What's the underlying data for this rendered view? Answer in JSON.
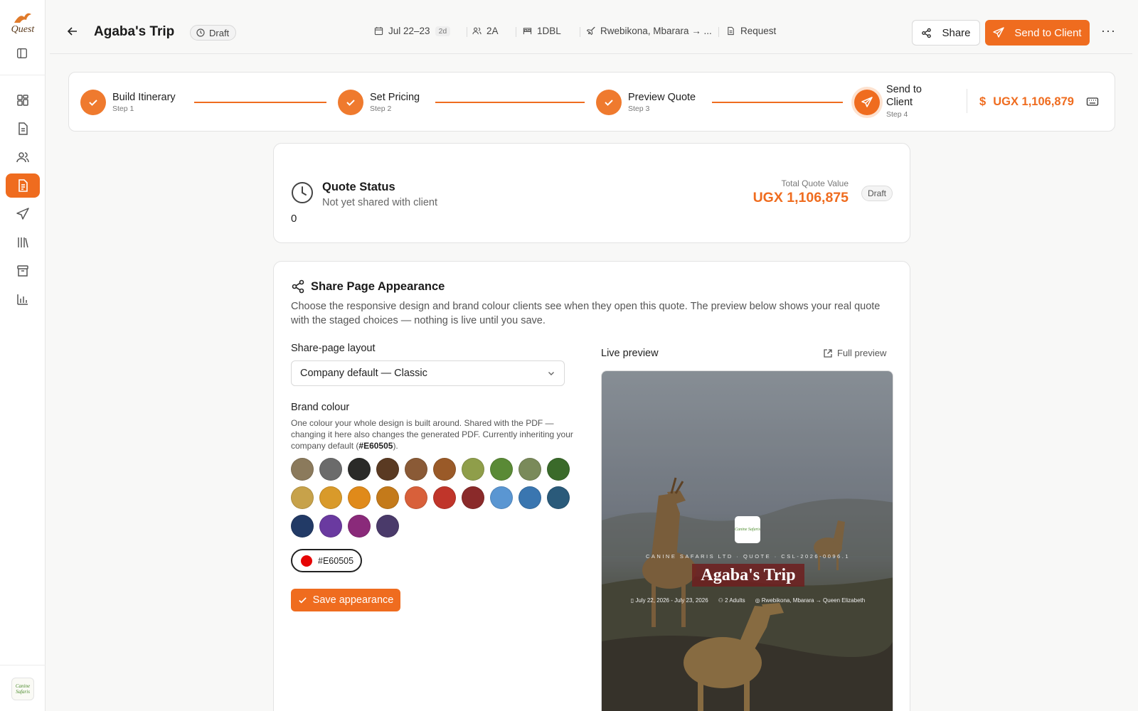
{
  "app": {
    "logo_text": "Quest",
    "avatar_text": "Canine Safaris"
  },
  "header": {
    "trip_title": "Agaba's Trip",
    "status_pill": "Draft",
    "dates": "Jul 22–23",
    "duration": "2d",
    "adults": "2A",
    "rooms": "1DBL",
    "route": "Rwebikona, Mbarara → ...",
    "request": "Request",
    "share_label": "Share",
    "send_label": "Send to Client",
    "more_label": "···"
  },
  "stepper": {
    "steps": [
      {
        "label": "Build Itinerary",
        "sub": "Step 1"
      },
      {
        "label": "Set Pricing",
        "sub": "Step 2"
      },
      {
        "label": "Preview Quote",
        "sub": "Step 3"
      },
      {
        "label": "Send to",
        "label2": "Client",
        "sub": "Step 4"
      }
    ],
    "currency_symbol": "$",
    "total": "UGX 1,106,879"
  },
  "quote_status": {
    "title": "Quote Status",
    "subtitle": "Not yet shared with client",
    "count": "0",
    "total_label": "Total Quote Value",
    "total_value": "UGX 1,106,875",
    "badge": "Draft"
  },
  "appearance": {
    "title": "Share Page Appearance",
    "description": "Choose the responsive design and brand colour clients see when they open this quote. The preview below shows your real quote with the staged choices — nothing is live until you save.",
    "layout_label": "Share-page layout",
    "layout_value": "Company default — Classic",
    "brand_label": "Brand colour",
    "brand_desc_1": "One colour your whole design is built around. Shared with the PDF — changing it here also changes the generated PDF. Currently inheriting your company default (",
    "brand_desc_hex": "#E60505",
    "brand_desc_2": ").",
    "swatches": [
      "#8b7a5c",
      "#6b6b6b",
      "#2a2a28",
      "#5a3a22",
      "#8a5a36",
      "#9a5a28",
      "#8f9e4a",
      "#5a8a36",
      "#7a8a5a",
      "#3a6a2a",
      "#c7a24a",
      "#d99a2a",
      "#e08a1a",
      "#c47a1a",
      "#d8603a",
      "#c0352a",
      "#8a2a2a",
      "#5a96d2",
      "#3a76b0",
      "#2a5a7a",
      "#223a66",
      "#6a3aa0",
      "#8a2a7a",
      "#4a3a6a"
    ],
    "selected_hex": "#E60505",
    "save_label": "Save appearance",
    "preview_label": "Live preview",
    "full_preview_label": "Full preview",
    "preview": {
      "logo_text": "Canine Safaris",
      "eyebrow": "CANINE SAFARIS LTD · QUOTE · CSL-2026-0096.1",
      "title": "Agaba's Trip",
      "dates": "July 22, 2026 - July 23, 2026",
      "adults": "2 Adults",
      "route": "Rwebikona, Mbarara → Queen Elizabeth"
    }
  },
  "colors": {
    "accent": "#ef6c1f",
    "selected_swatch": "#E60505"
  },
  "icons": [
    "collapse-icon",
    "dashboard-icon",
    "document-icon",
    "users-icon",
    "quotes-icon",
    "send-icon",
    "library-icon",
    "archive-icon",
    "chart-icon",
    "back-arrow-icon",
    "clock-icon",
    "calendar-icon",
    "people-icon",
    "bed-icon",
    "plane-icon",
    "request-icon",
    "share-icon",
    "send-icon",
    "check-icon",
    "keyboard-icon",
    "chevron-down-icon",
    "external-link-icon"
  ]
}
